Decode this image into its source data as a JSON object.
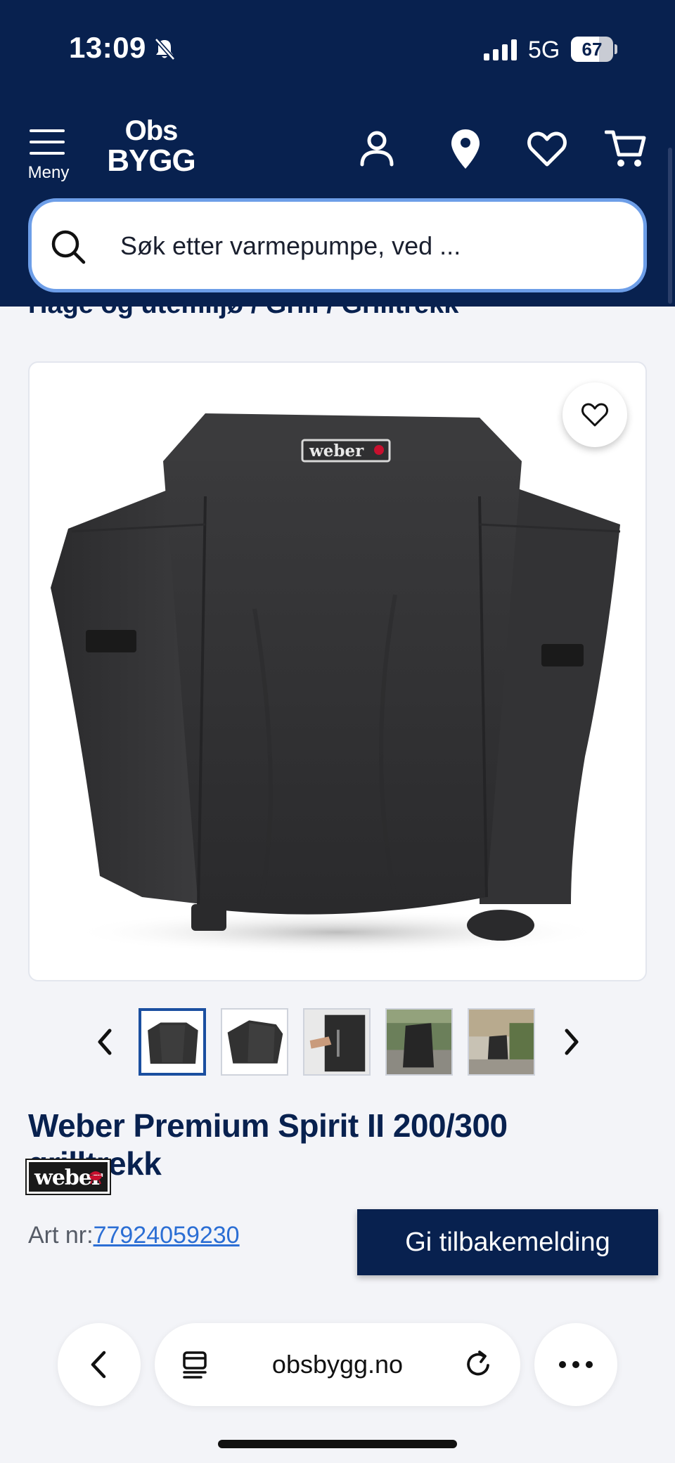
{
  "status_bar": {
    "time": "13:09",
    "network": "5G",
    "battery": "67",
    "battery_level": 0.67
  },
  "header": {
    "menu_label": "Meny",
    "logo_top": "Obs",
    "logo_bottom": "BYGG",
    "icons": [
      "account-icon",
      "location-pin-icon",
      "heart-icon",
      "cart-icon"
    ]
  },
  "search": {
    "placeholder": "Søk etter varmepumpe, ved ..."
  },
  "breadcrumb": "Hage og utemiljø / Grill / Grilltrekk",
  "product": {
    "title": "Weber Premium Spirit II 200/300 grilltrekk",
    "brand": "weber",
    "cover_logo": "weber",
    "artnr_label": "Art nr:",
    "artnr_value": "77924059230",
    "feedback_label": "Gi tilbakemelding",
    "thumbnails": [
      {
        "name": "thumb-front"
      },
      {
        "name": "thumb-angle"
      },
      {
        "name": "thumb-zip"
      },
      {
        "name": "thumb-outdoor"
      },
      {
        "name": "thumb-patio"
      }
    ]
  },
  "browser": {
    "url": "obsbygg.no"
  },
  "colors": {
    "navy": "#08214f",
    "link": "#2b6ed4",
    "search_border": "#6d9ee8"
  }
}
